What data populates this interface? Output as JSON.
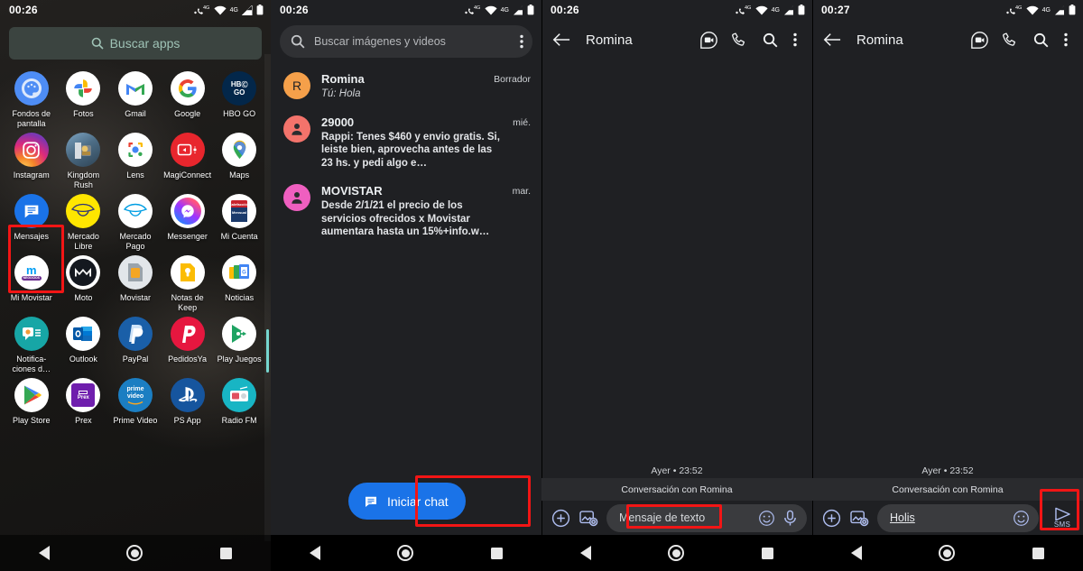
{
  "panels": {
    "drawer": {
      "status": {
        "clock": "00:26"
      },
      "search": {
        "placeholder": "Buscar apps",
        "icon": "search-icon"
      },
      "apps": [
        {
          "label": "Fondos de pantalla",
          "icon": "wallpapers-icon"
        },
        {
          "label": "Fotos",
          "icon": "google-photos-icon"
        },
        {
          "label": "Gmail",
          "icon": "gmail-icon"
        },
        {
          "label": "Google",
          "icon": "google-icon"
        },
        {
          "label": "HBO GO",
          "icon": "hbo-go-icon"
        },
        {
          "label": "Instagram",
          "icon": "instagram-icon"
        },
        {
          "label": "Kingdom Rush",
          "icon": "kingdom-rush-icon"
        },
        {
          "label": "Lens",
          "icon": "google-lens-icon"
        },
        {
          "label": "MagiConnect",
          "icon": "magiconnect-icon"
        },
        {
          "label": "Maps",
          "icon": "google-maps-icon"
        },
        {
          "label": "Mensajes",
          "icon": "messages-icon"
        },
        {
          "label": "Mercado Libre",
          "icon": "mercado-libre-icon"
        },
        {
          "label": "Mercado Pago",
          "icon": "mercado-pago-icon"
        },
        {
          "label": "Messenger",
          "icon": "messenger-icon"
        },
        {
          "label": "Mi Cuenta",
          "icon": "mi-cuenta-icon"
        },
        {
          "label": "Mi Movistar",
          "icon": "mi-movistar-icon"
        },
        {
          "label": "Moto",
          "icon": "moto-icon"
        },
        {
          "label": "Movistar",
          "icon": "movistar-sim-icon"
        },
        {
          "label": "Notas de Keep",
          "icon": "google-keep-icon"
        },
        {
          "label": "Noticias",
          "icon": "google-news-icon"
        },
        {
          "label": "Notifica-ciones d…",
          "icon": "notifications-icon"
        },
        {
          "label": "Outlook",
          "icon": "outlook-icon"
        },
        {
          "label": "PayPal",
          "icon": "paypal-icon"
        },
        {
          "label": "PedidosYa",
          "icon": "pedidosya-icon"
        },
        {
          "label": "Play Juegos",
          "icon": "play-games-icon"
        },
        {
          "label": "Play Store",
          "icon": "play-store-icon"
        },
        {
          "label": "Prex",
          "icon": "prex-icon"
        },
        {
          "label": "Prime Video",
          "icon": "prime-video-icon"
        },
        {
          "label": "PS App",
          "icon": "playstation-icon"
        },
        {
          "label": "Radio FM",
          "icon": "radio-fm-icon"
        }
      ],
      "highlight": "Mensajes"
    },
    "conversations": {
      "status": {
        "clock": "00:26"
      },
      "search": {
        "placeholder": "Buscar imágenes y videos",
        "icon": "search-icon",
        "overflow_icon": "more-vert-icon"
      },
      "items": [
        {
          "avatar_letter": "R",
          "avatar_color": "#f5a04a",
          "name": "Romina",
          "snippet": "Tú: Hola",
          "time": "Borrador",
          "is_draft": true
        },
        {
          "avatar_letter": "",
          "avatar_color": "#f3736b",
          "name": "29000",
          "snippet": "Rappi: Tenes $460 y envio gratis. Si, leiste bien, aprovecha antes de las 23 hs. y pedi algo e…",
          "time": "mié.",
          "is_draft": false
        },
        {
          "avatar_letter": "",
          "avatar_color": "#ef5fc0",
          "name": "MOVISTAR",
          "snippet": "Desde 2/1/21 el precio de los servicios ofrecidos x Movistar aumentara hasta un 15%+info.w…",
          "time": "mar.",
          "is_draft": false
        }
      ],
      "fab": {
        "label": "Iniciar chat",
        "icon": "chat-bubble-icon",
        "color": "#1a73e8"
      }
    },
    "chat_empty": {
      "status": {
        "clock": "00:26"
      },
      "appbar": {
        "back_icon": "arrow-back-icon",
        "title": "Romina",
        "video_icon": "duo-video-call-icon",
        "call_icon": "phone-icon",
        "search_icon": "search-icon",
        "overflow_icon": "more-vert-icon"
      },
      "daystamp": "Ayer • 23:52",
      "conversation_with": "Conversación con Romina",
      "composer": {
        "plus_icon": "add-circle-icon",
        "gallery_icon": "gallery-camera-icon",
        "input_value": "",
        "input_placeholder": "Mensaje de texto",
        "emoji_icon": "emoji-icon",
        "mic_icon": "microphone-icon"
      }
    },
    "chat_typed": {
      "status": {
        "clock": "00:27"
      },
      "appbar": {
        "back_icon": "arrow-back-icon",
        "title": "Romina",
        "video_icon": "duo-video-call-icon",
        "call_icon": "phone-icon",
        "search_icon": "search-icon",
        "overflow_icon": "more-vert-icon"
      },
      "daystamp": "Ayer • 23:52",
      "conversation_with": "Conversación con Romina",
      "composer": {
        "plus_icon": "add-circle-icon",
        "gallery_icon": "gallery-camera-icon",
        "input_value": "Holis",
        "input_placeholder": "Mensaje de texto",
        "emoji_icon": "emoji-icon",
        "send_icon": "send-icon",
        "send_label": "SMS"
      }
    }
  },
  "status_icons": {
    "signal_label": "4G",
    "volte_label": "4G",
    "wifi_icon": "wifi-icon",
    "signal_icon": "signal-icon",
    "battery_icon": "battery-icon",
    "call_icon": "volte-call-icon"
  },
  "navbar": {
    "back_icon": "nav-back-icon",
    "home_icon": "nav-home-icon",
    "recents_icon": "nav-recents-icon"
  },
  "highlight_color": "#f21515"
}
